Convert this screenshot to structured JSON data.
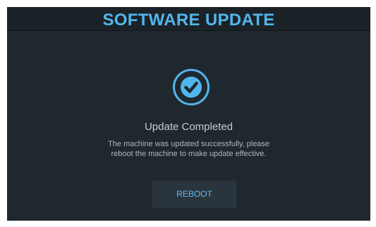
{
  "header": {
    "title": "SOFTWARE UPDATE"
  },
  "status": {
    "icon": "check-circle-icon",
    "title": "Update Completed",
    "message_line1": "The machine was updated successfully, please",
    "message_line2": "reboot the machine to make update effective."
  },
  "actions": {
    "reboot_label": "REBOOT"
  },
  "colors": {
    "accent": "#52b6ec",
    "background": "#1f282f",
    "header_background": "#1b2227",
    "button_background": "#2a343d"
  }
}
